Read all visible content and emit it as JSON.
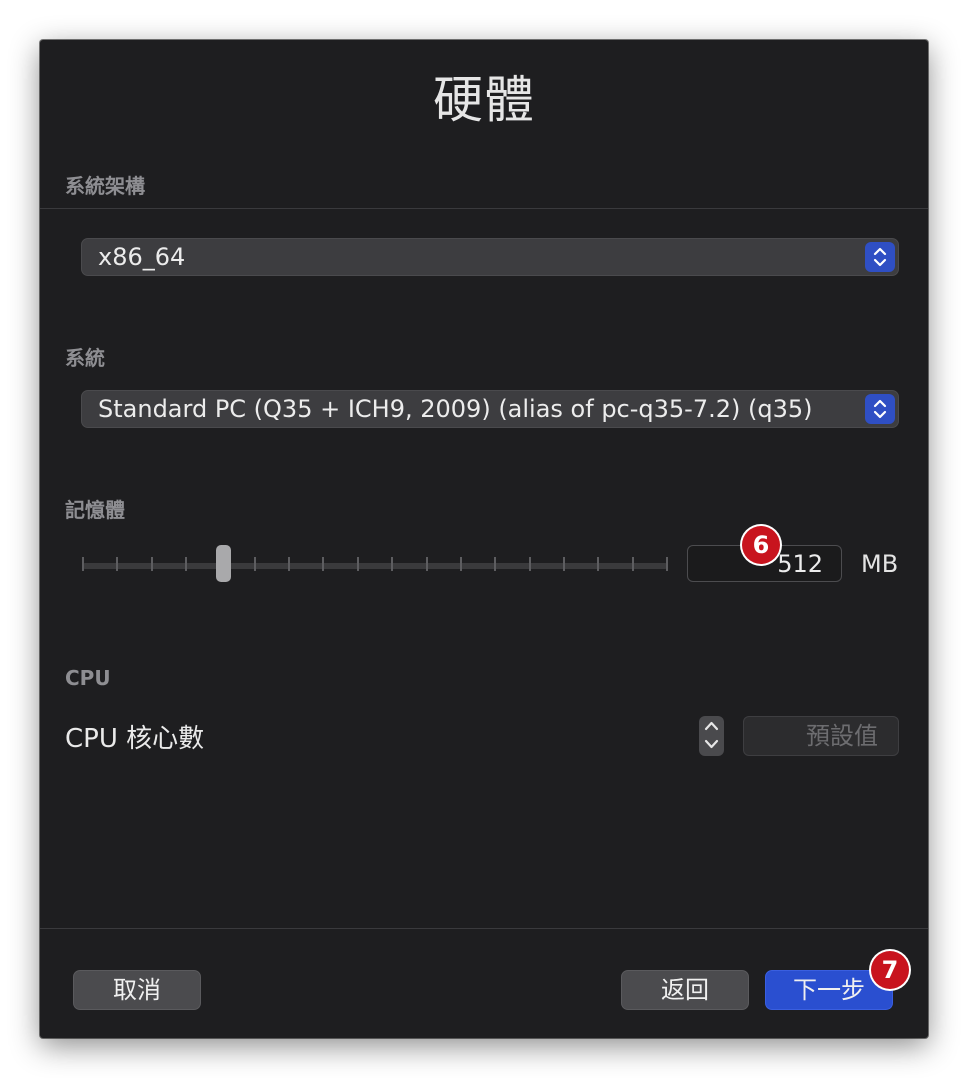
{
  "window": {
    "title": "硬體"
  },
  "architecture": {
    "label": "系統架構",
    "value": "x86_64"
  },
  "system": {
    "label": "系統",
    "value": "Standard PC (Q35 + ICH9, 2009) (alias of pc-q35-7.2) (q35)"
  },
  "memory": {
    "label": "記憶體",
    "value": "512",
    "unit": "MB",
    "slider_position": 0.24
  },
  "cpu": {
    "section_label": "CPU",
    "cores_label": "CPU 核心數",
    "default_placeholder": "預設值"
  },
  "footer": {
    "cancel_label": "取消",
    "back_label": "返回",
    "next_label": "下一步"
  },
  "badges": {
    "memory_badge": "6",
    "next_badge": "7"
  },
  "colors": {
    "accent": "#2a4fd0",
    "badge": "#c8141e",
    "background": "#1e1e20"
  }
}
